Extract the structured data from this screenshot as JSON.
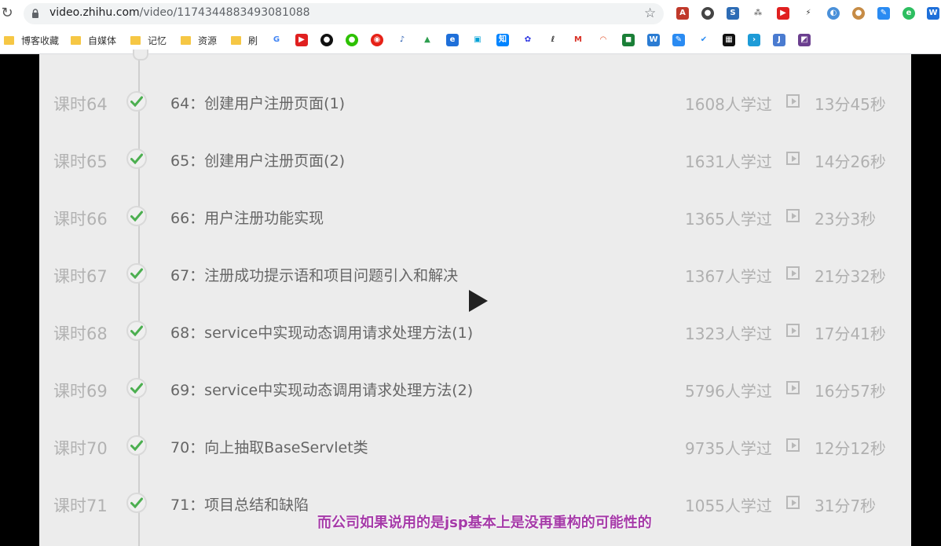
{
  "browser": {
    "url_domain": "video.zhihu.com",
    "url_path": "/video/1174344883493081088"
  },
  "bookmarks": [
    {
      "label": "博客收藏"
    },
    {
      "label": "自媒体"
    },
    {
      "label": "记忆"
    },
    {
      "label": "资源"
    },
    {
      "label": "刷"
    }
  ],
  "lessons": [
    {
      "lesson": "课时64",
      "title": "64：创建用户注册页面(1)",
      "learners": "1608人学过",
      "duration": "13分45秒"
    },
    {
      "lesson": "课时65",
      "title": "65：创建用户注册页面(2)",
      "learners": "1631人学过",
      "duration": "14分26秒"
    },
    {
      "lesson": "课时66",
      "title": "66：用户注册功能实现",
      "learners": "1365人学过",
      "duration": "23分3秒"
    },
    {
      "lesson": "课时67",
      "title": "67：注册成功提示语和项目问题引入和解决",
      "learners": "1367人学过",
      "duration": "21分32秒"
    },
    {
      "lesson": "课时68",
      "title": "68：service中实现动态调用请求处理方法(1)",
      "learners": "1323人学过",
      "duration": "17分41秒"
    },
    {
      "lesson": "课时69",
      "title": "69：service中实现动态调用请求处理方法(2)",
      "learners": "5796人学过",
      "duration": "16分57秒"
    },
    {
      "lesson": "课时70",
      "title": "70：向上抽取BaseServlet类",
      "learners": "9735人学过",
      "duration": "12分12秒"
    },
    {
      "lesson": "课时71",
      "title": "71：项目总结和缺陷",
      "learners": "1055人学过",
      "duration": "31分7秒"
    }
  ],
  "subtitle": "而公司如果说用的是jsp基本上是没再重构的可能性的",
  "colors": {
    "subtitle": "#a53aa8",
    "check": "#4caf50",
    "panel": "#ececec"
  }
}
